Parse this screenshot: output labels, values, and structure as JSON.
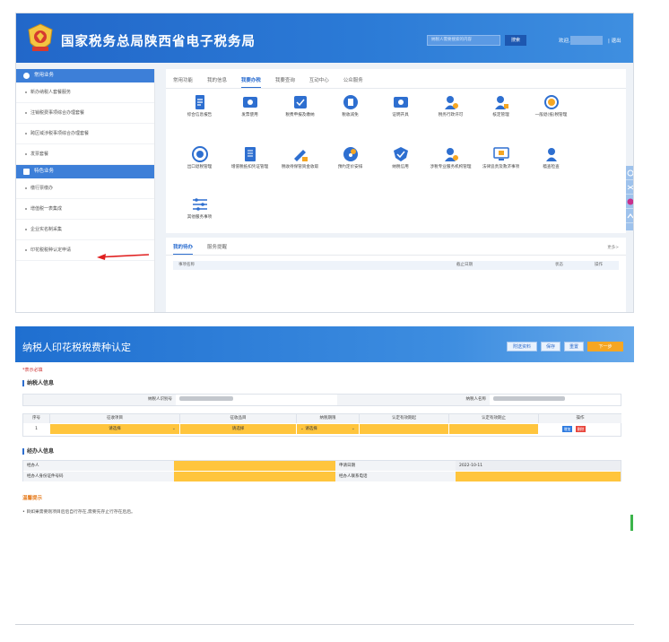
{
  "top": {
    "site_title": "国家税务总局陕西省电子税务局",
    "search_placeholder": "纳税人需要搜索的内容",
    "search_button": "搜索",
    "welcome": "欢迎,",
    "logout": "| 退出",
    "sidebar": {
      "group1": "常用业务",
      "items1": [
        "新办纳税人套餐服务",
        "注销税费事项综合办理套餐",
        "跨区域涉税事项综合办理套餐",
        "发票套餐"
      ],
      "group2": "特色业务",
      "items2": [
        "缴行票缴办",
        "增值税一表集成",
        "企业实名制采集",
        "印花税税种认定申请"
      ]
    },
    "tabs": [
      "常用功能",
      "我的信息",
      "我要办税",
      "我要查询",
      "互动中心",
      "公众服务"
    ],
    "active_tab": "我要办税",
    "tiles": [
      {
        "label": "综合信息报告",
        "icon": "document-icon",
        "color": "#2e6fd0"
      },
      {
        "label": "发票使用",
        "icon": "invoice-icon",
        "color": "#2e6fd0"
      },
      {
        "label": "税费申报及缴纳",
        "icon": "tax-declaration-icon",
        "color": "#2e6fd0"
      },
      {
        "label": "税收减免",
        "icon": "tax-reduction-icon",
        "color": "#2e6fd0"
      },
      {
        "label": "证明开具",
        "icon": "certificate-icon",
        "color": "#2e6fd0"
      },
      {
        "label": "税务行政许可",
        "icon": "administrative-permit-icon",
        "color": "#2e6fd0"
      },
      {
        "label": "核定管理",
        "icon": "assessment-icon",
        "color": "#2e6fd0"
      },
      {
        "label": "一般退(抵)税管理",
        "icon": "tax-refund-icon",
        "color": "#2e6fd0"
      },
      {
        "label": "出口退税管理",
        "icon": "export-rebate-icon",
        "color": "#2e6fd0"
      },
      {
        "label": "增值税抵扣凭证管理",
        "icon": "vat-deduction-icon",
        "color": "#2e6fd0"
      },
      {
        "label": "税收待保管资金收取",
        "icon": "fund-custody-icon",
        "color": "#2e6fd0"
      },
      {
        "label": "预约定价安排",
        "icon": "pricing-arrangement-icon",
        "color": "#2e6fd0"
      },
      {
        "label": "纳税信用",
        "icon": "tax-credit-icon",
        "color": "#2e6fd0"
      },
      {
        "label": "涉税专业服务机构管理",
        "icon": "service-agency-icon",
        "color": "#2e6fd0"
      },
      {
        "label": "法律追责及救济事项",
        "icon": "legal-remedy-icon",
        "color": "#2e6fd0"
      },
      {
        "label": "稽查检查",
        "icon": "inspection-icon",
        "color": "#2e6fd0"
      },
      {
        "label": "其他服务事项",
        "icon": "other-services-icon",
        "color": "#2e6fd0"
      }
    ],
    "todo": {
      "tabs": [
        "我的待办",
        "服务提醒"
      ],
      "more": "更多>",
      "columns": [
        "事项名称",
        "截止日期",
        "状态",
        "操作"
      ]
    }
  },
  "bottom": {
    "title": "纳税人印花税税费种认定",
    "buttons": [
      "附送资料",
      "保存",
      "重置",
      "下一步"
    ],
    "required_note": "*表示必填",
    "section1": "纳税人信息",
    "taxpayer_id_label": "纳税人识别号",
    "taxpayer_name_label": "纳税人名称",
    "table": {
      "headers": [
        "序号",
        "征收项目",
        "征收品目",
        "纳税期限",
        "认定有效期起",
        "认定有效期止",
        "操作"
      ],
      "row": {
        "index": "1",
        "item": "请选择",
        "sub_item": "请选择",
        "period": "请选择",
        "start": "",
        "end": ""
      },
      "add": "增加",
      "delete": "删除"
    },
    "section2": "经办人信息",
    "agent_label": "经办人",
    "agent_id_label": "经办人身份证件号码",
    "apply_date_label": "申请日期",
    "apply_date": "2022-10-11",
    "agent_phone_label": "经办人联系电话",
    "tips_title": "温馨提示",
    "tips_text": "• 目如果需要刚项目后后自行存在,需要先存止行存在后后。"
  }
}
